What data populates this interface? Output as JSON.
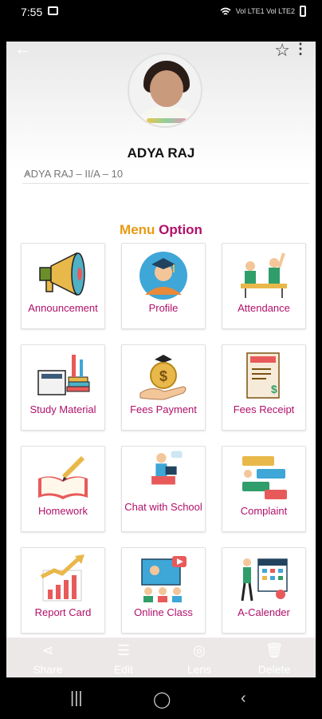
{
  "status": {
    "time": "7:55",
    "net_label": "Vol LTE1 Vol LTE2"
  },
  "profile": {
    "name": "ADYA RAJ",
    "class_select_value": "ADYA RAJ – II/A – 10"
  },
  "menu": {
    "title_part1": "Menu",
    "title_part2": "Option",
    "items": [
      {
        "label": "Announcement",
        "icon": "megaphone-icon"
      },
      {
        "label": "Profile",
        "icon": "graduate-avatar-icon"
      },
      {
        "label": "Attendance",
        "icon": "students-raising-hands-icon"
      },
      {
        "label": "Study Material",
        "icon": "books-calculator-icon"
      },
      {
        "label": "Fees Payment",
        "icon": "money-bag-hand-icon"
      },
      {
        "label": "Fees Receipt",
        "icon": "receipt-icon"
      },
      {
        "label": "Homework",
        "icon": "book-pencil-icon"
      },
      {
        "label": "Chat with School",
        "icon": "person-laptop-icon"
      },
      {
        "label": "Complaint",
        "icon": "chat-bubbles-icon"
      },
      {
        "label": "Report Card",
        "icon": "growth-chart-icon"
      },
      {
        "label": "Online Class",
        "icon": "video-class-icon"
      },
      {
        "label": "A-Calender",
        "icon": "calendar-person-icon"
      }
    ]
  },
  "sharebar": {
    "share": "Share",
    "edit": "Edit",
    "lens": "Lens",
    "delete": "Delete"
  },
  "colors": {
    "accent": "#b0106a",
    "title_orange": "#e89a12"
  }
}
